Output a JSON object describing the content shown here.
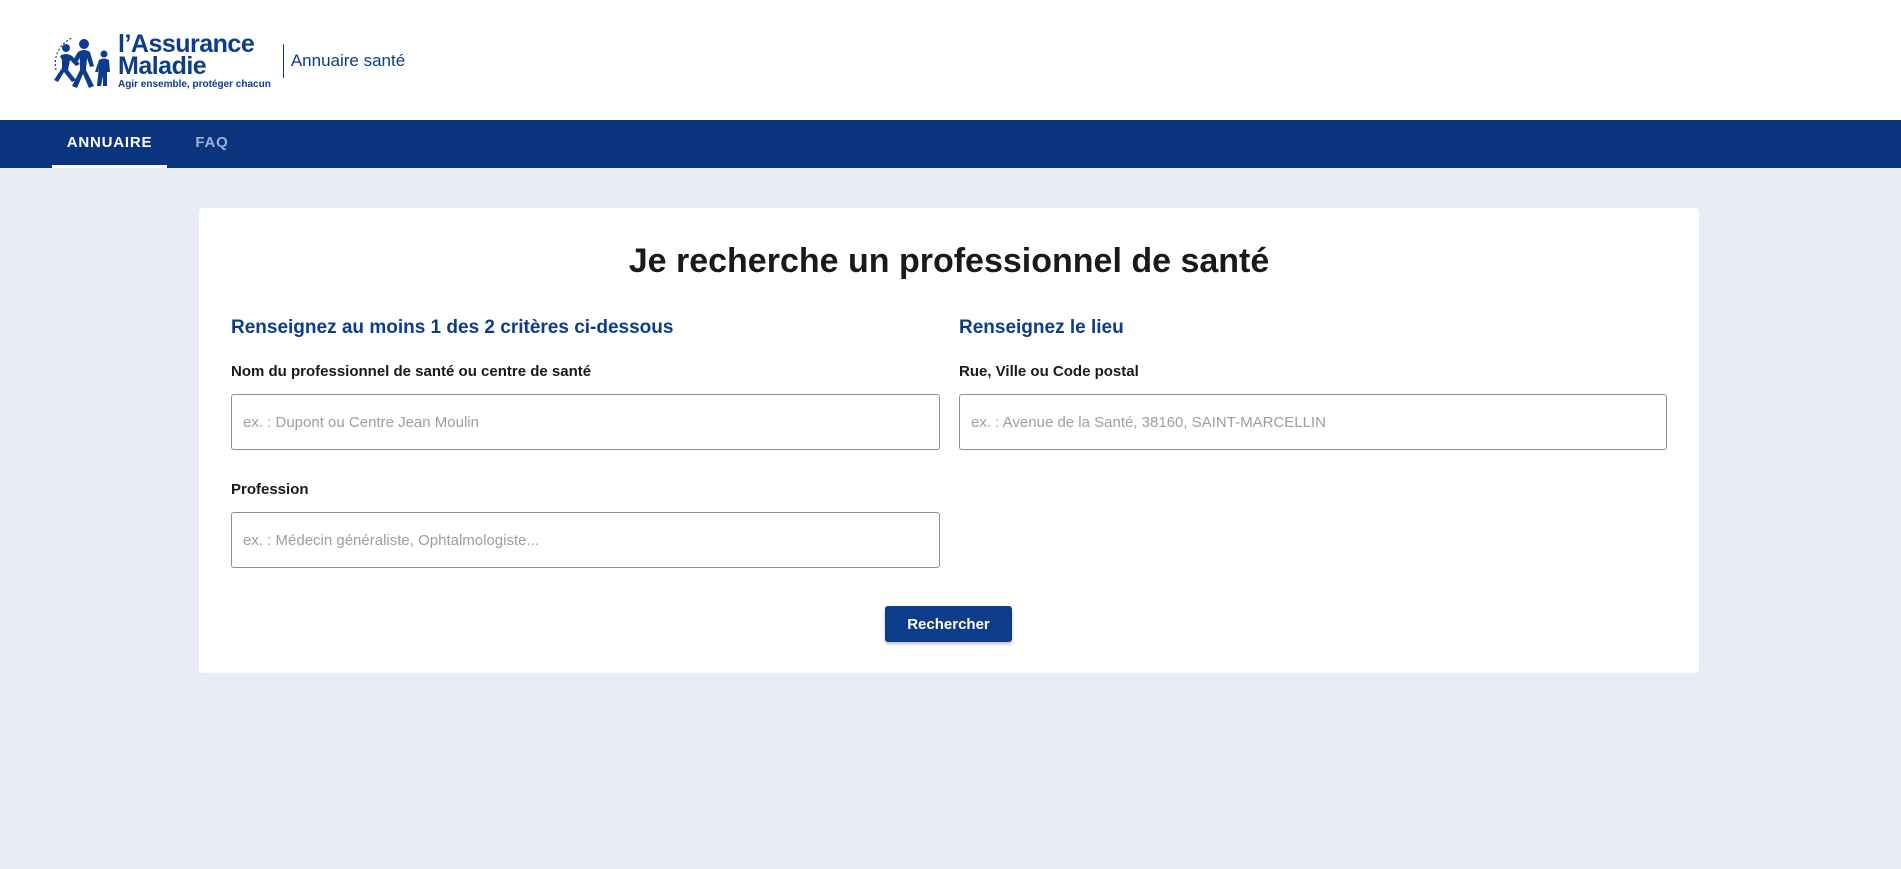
{
  "brand": {
    "name_line1": "l’Assurance",
    "name_line2": "Maladie",
    "tagline": "Agir ensemble, protéger chacun",
    "subtitle": "Annuaire santé",
    "color": "#0c3c8a"
  },
  "nav": {
    "background": "#0b347f",
    "tabs": [
      {
        "label": "ANNUAIRE",
        "active": true
      },
      {
        "label": "FAQ",
        "active": false
      }
    ]
  },
  "search": {
    "title": "Je recherche un professionnel de santé",
    "criteria": {
      "heading": "Renseignez au moins 1 des 2 critères ci-dessous",
      "name_label": "Nom du professionnel de santé ou centre de santé",
      "name_value": "",
      "name_placeholder": "ex. : Dupont ou Centre Jean Moulin",
      "profession_label": "Profession",
      "profession_value": "",
      "profession_placeholder": "ex. : Médecin généraliste, Ophtalmologiste..."
    },
    "location": {
      "heading": "Renseignez le lieu",
      "address_label": "Rue, Ville ou Code postal",
      "address_value": "",
      "address_placeholder": "ex. : Avenue de la Santé, 38160, SAINT-MARCELLIN"
    },
    "submit_label": "Rechercher"
  }
}
